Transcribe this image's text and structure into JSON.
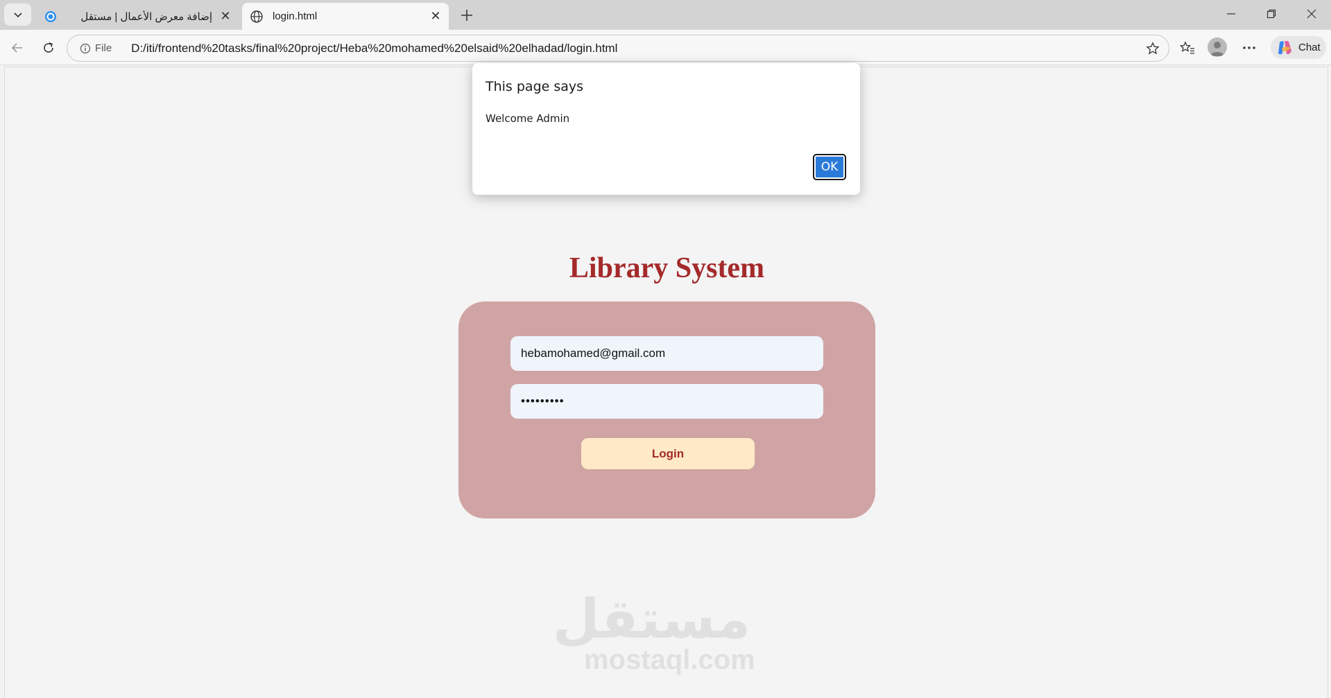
{
  "browser": {
    "tabs": [
      {
        "title": "إضافة معرض الأعمال | مستقل",
        "favicon": "mostaql-favicon"
      },
      {
        "title": "login.html",
        "favicon": "globe-icon"
      }
    ],
    "address": {
      "scheme_label": "File",
      "url": "D:/iti/frontend%20tasks/final%20project/Heba%20mohamed%20elsaid%20elhadad/login.html"
    },
    "chat_label": "Chat"
  },
  "page": {
    "title": "Library System",
    "email_value": "hebamohamed@gmail.com",
    "password_value": "•••••••••",
    "login_label": "Login",
    "colors": {
      "title": "#a42a2a",
      "card": "#d0a4a4",
      "input": "#eff5fb",
      "button": "#ffe9c7"
    }
  },
  "watermark": {
    "arabic": "مستقل",
    "latin": "mostaql.com"
  },
  "dialog": {
    "title": "This page says",
    "message": "Welcome Admin",
    "ok_label": "OK",
    "ok_color": "#2a7ad9"
  }
}
